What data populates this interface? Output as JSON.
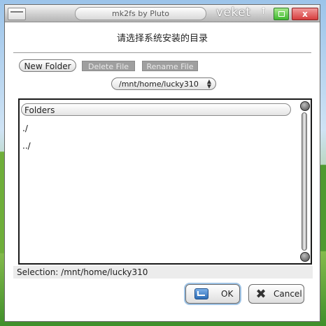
{
  "window": {
    "title": "mk2fs by Pluto",
    "brand": "veket",
    "close_label": "x",
    "up_label": "↑"
  },
  "dialog": {
    "header": "请选择系统安装的目录"
  },
  "toolbar": {
    "new_folder": "New Folder",
    "delete_file": "Delete File",
    "rename_file": "Rename File"
  },
  "path_combo": {
    "value": "/mnt/home/lucky310"
  },
  "file_panel": {
    "column_header": "Folders",
    "items": [
      "./",
      "../"
    ]
  },
  "selection": {
    "text": "Selection: /mnt/home/lucky310"
  },
  "actions": {
    "ok": "OK",
    "cancel": "Cancel"
  },
  "colors": {
    "close_button": "#d63d3d",
    "maximize_button": "#3fb82f",
    "ok_focus_ring": "#9fc4e6"
  }
}
